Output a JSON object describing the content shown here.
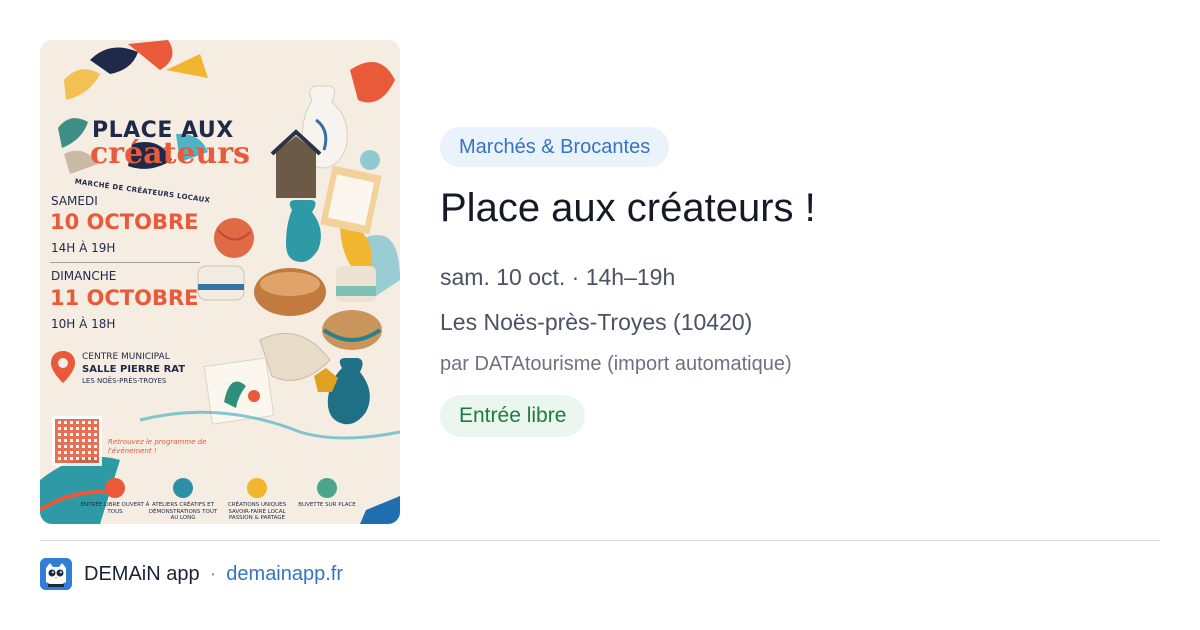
{
  "poster": {
    "title_line1": "PLACE AUX",
    "title_line2": "créateurs",
    "subtitle": "MARCHÉ DE CRÉATEURS LOCAUX",
    "day1": "SAMEDI",
    "date1": "10 OCTOBRE",
    "time1": "14H À 19H",
    "day2": "DIMANCHE",
    "date2": "11 OCTOBRE",
    "time2": "10H À 18H",
    "venue_line1": "CENTRE MUNICIPAL",
    "venue_line2": "SALLE PIERRE RAT",
    "venue_line3": "LES NOËS-PRÈS-TROYES",
    "qr_text": "Retrouvez le programme de l'événement !",
    "features": [
      {
        "label": "ENTRÉE LIBRE OUVERT À TOUS",
        "color": "#e85a3a"
      },
      {
        "label": "ATELIERS CRÉATIFS ET DÉMONSTRATIONS TOUT AU LONG",
        "color": "#2d8fa8"
      },
      {
        "label": "CRÉATIONS UNIQUES SAVOIR-FAIRE LOCAL PASSION & PARTAGE",
        "color": "#f2b530"
      },
      {
        "label": "BUVETTE SUR PLACE",
        "color": "#4aa58a"
      }
    ]
  },
  "event": {
    "category": "Marchés & Brocantes",
    "title": "Place aux créateurs !",
    "when": "sam. 10 oct. · 14h–19h",
    "where": "Les Noës-près-Troyes (10420)",
    "source": "par DATAtourisme (import automatique)",
    "price": "Entrée libre"
  },
  "footer": {
    "app_name": "DEMAiN app",
    "separator": "·",
    "domain": "demainapp.fr",
    "icon": "owl-icon"
  },
  "colors": {
    "category_bg": "#eaf2fc",
    "category_fg": "#3574c4",
    "price_bg": "#ebf7ee",
    "price_fg": "#1f7a3e",
    "poster_accent": "#e85a3a"
  }
}
